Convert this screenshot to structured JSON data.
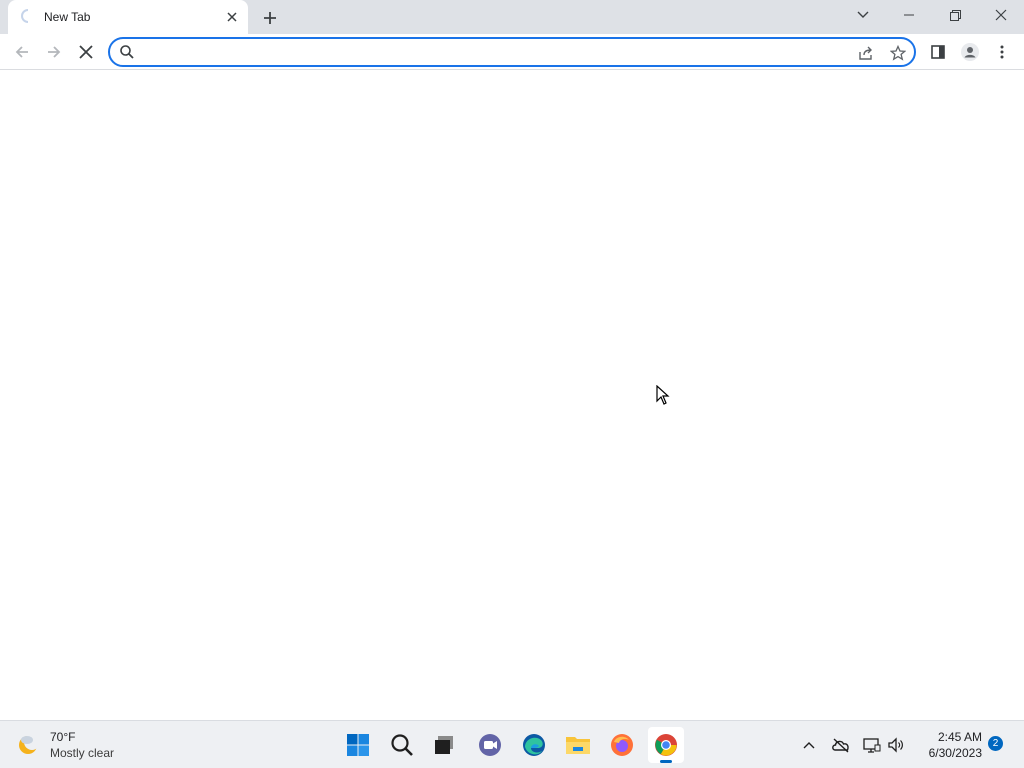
{
  "browser": {
    "tab": {
      "title": "New Tab"
    },
    "omnibox": {
      "value": "",
      "placeholder": ""
    }
  },
  "taskbar": {
    "weather": {
      "temp": "70°F",
      "condition": "Mostly clear"
    },
    "clock": {
      "time": "2:45 AM",
      "date": "6/30/2023"
    },
    "notification_count": "2",
    "apps": [
      "start",
      "search",
      "task-view",
      "teams-chat",
      "edge",
      "file-explorer",
      "firefox",
      "chrome"
    ]
  },
  "colors": {
    "accent": "#1a73e8",
    "tabstrip": "#dee1e6",
    "taskbar": "#eef0f3",
    "windows_blue": "#0067c0"
  }
}
